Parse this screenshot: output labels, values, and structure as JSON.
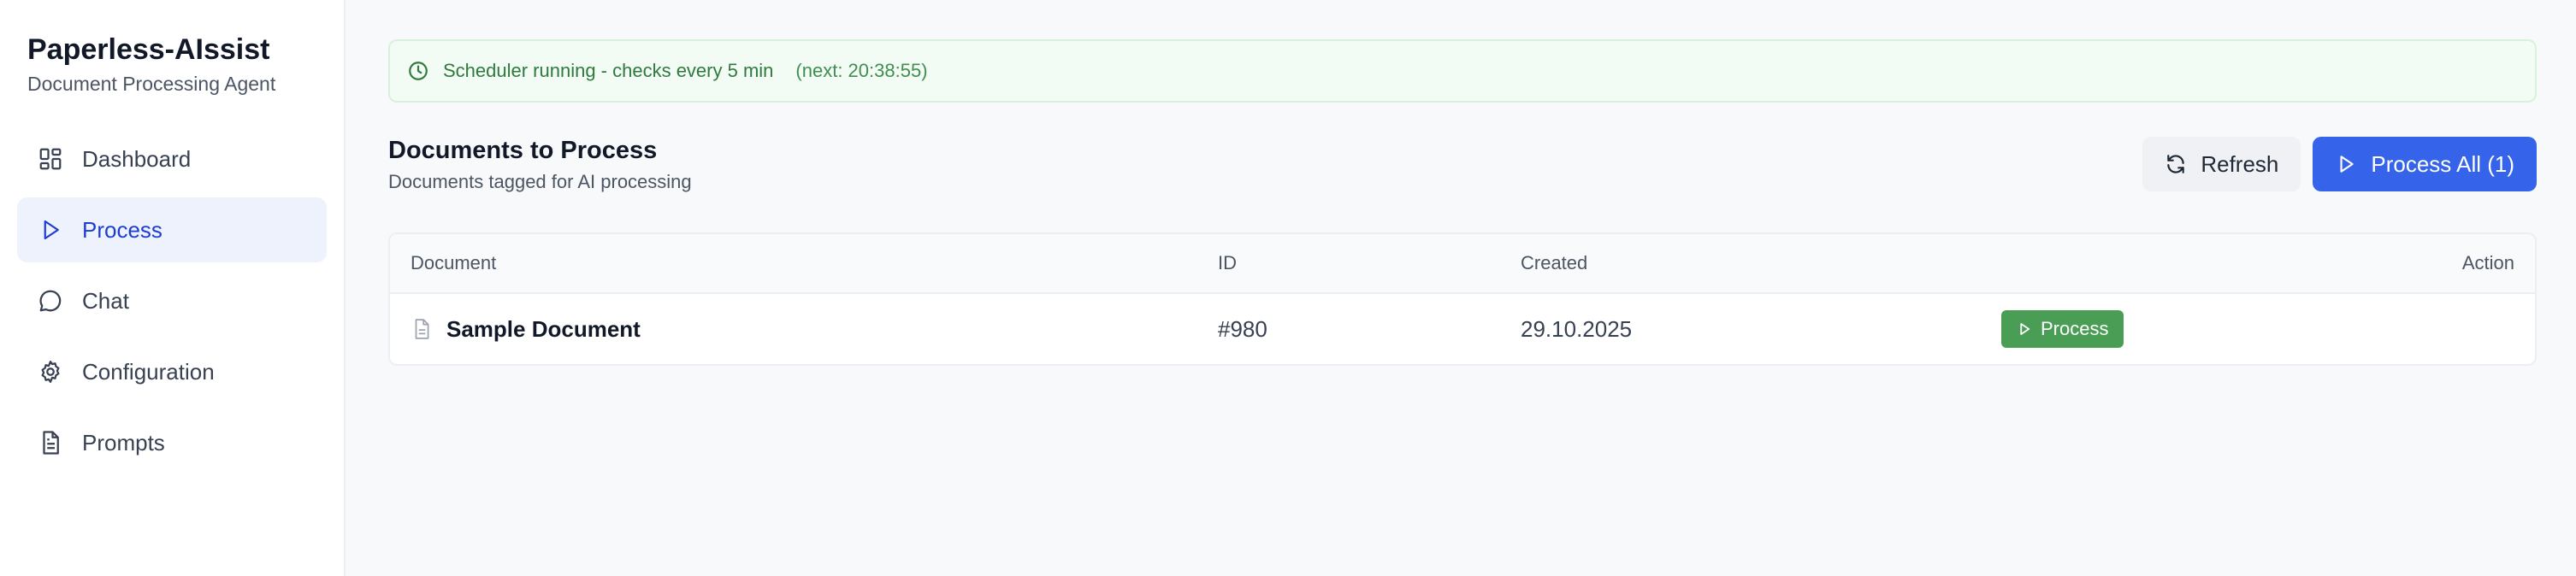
{
  "brand": {
    "title": "Paperless-AIssist",
    "subtitle": "Document Processing Agent"
  },
  "sidebar": {
    "items": [
      {
        "label": "Dashboard",
        "icon": "dashboard-icon",
        "active": false
      },
      {
        "label": "Process",
        "icon": "play-icon",
        "active": true
      },
      {
        "label": "Chat",
        "icon": "chat-icon",
        "active": false
      },
      {
        "label": "Configuration",
        "icon": "gear-icon",
        "active": false
      },
      {
        "label": "Prompts",
        "icon": "file-text-icon",
        "active": false
      }
    ]
  },
  "scheduler": {
    "status": "Scheduler running - checks every 5 min",
    "next": "(next: 20:38:55)",
    "icon": "clock-icon"
  },
  "section": {
    "title": "Documents to Process",
    "subtitle": "Documents tagged for AI processing"
  },
  "toolbar": {
    "refresh_label": "Refresh",
    "process_all_label": "Process All (1)"
  },
  "table": {
    "columns": [
      "Document",
      "ID",
      "Created",
      "Action"
    ],
    "rows": [
      {
        "document": "Sample Document",
        "id": "#980",
        "created": "29.10.2025",
        "action": "Process"
      }
    ]
  },
  "colors": {
    "accent": "#3563e9",
    "active_nav_bg": "#eef2fd",
    "success": "#4a9d54",
    "scheduler_bg": "#f2fbf4"
  }
}
